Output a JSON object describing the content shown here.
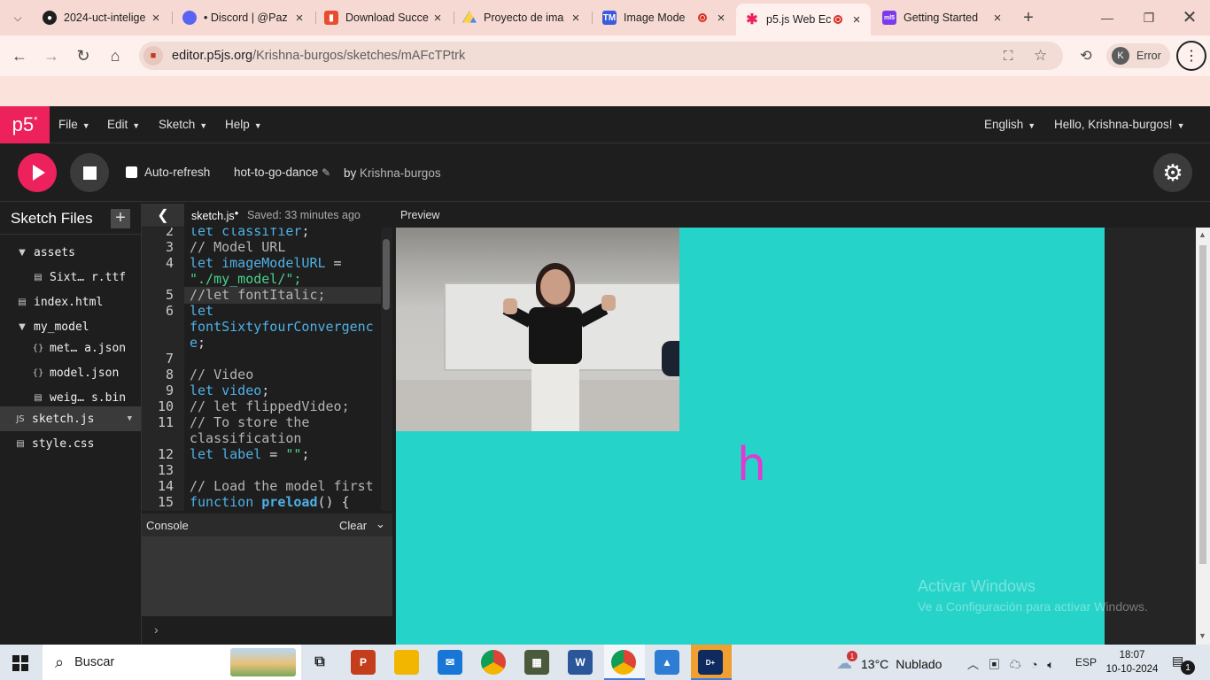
{
  "browser": {
    "tabs": [
      {
        "title": "2024-uct-intelige",
        "favicon": "github-icon",
        "color": "#1f1f1f"
      },
      {
        "title": "• Discord | @Paz",
        "favicon": "discord-icon",
        "color": "#5865f2"
      },
      {
        "title": "Download Succe",
        "favicon": "download-icon",
        "color": "#e94d2f"
      },
      {
        "title": "Proyecto de ima",
        "favicon": "google-drive-icon",
        "color": "#1fa463"
      },
      {
        "title": "Image Mode",
        "favicon": "teachable-machine-icon",
        "color": "#3b5bdb"
      },
      {
        "title": "p5.js Web Ec",
        "favicon": "p5js-icon",
        "color": "#ed225d"
      },
      {
        "title": "Getting Started",
        "favicon": "ml5-icon",
        "color": "#7c3aed"
      }
    ],
    "url_site": "editor.p5js.org",
    "url_path": "/Krishna-burgos/sketches/mAFcTPtrk",
    "profile_initial": "K",
    "profile_label": "Error"
  },
  "p5": {
    "logo": "p5",
    "menu": [
      "File",
      "Edit",
      "Sketch",
      "Help"
    ],
    "language": "English",
    "greeting": "Hello, Krishna-burgos!",
    "auto_refresh": "Auto-refresh",
    "sketch_name": "hot-to-go-dance",
    "by": "by",
    "author": "Krishna-burgos",
    "sidebar_title": "Sketch Files",
    "files": [
      {
        "name": "assets",
        "type": "folder"
      },
      {
        "name": "Sixt… r.ttf",
        "type": "file"
      },
      {
        "name": "index.html",
        "type": "html"
      },
      {
        "name": "my_model",
        "type": "folder"
      },
      {
        "name": "met… a.json",
        "type": "json"
      },
      {
        "name": "model.json",
        "type": "json"
      },
      {
        "name": "weig… s.bin",
        "type": "file"
      },
      {
        "name": "sketch.js",
        "type": "js"
      },
      {
        "name": "style.css",
        "type": "css"
      }
    ],
    "editor_tab": "sketch.js",
    "saved": "Saved: 33 minutes ago",
    "code_lines": [
      {
        "n": "2",
        "text": "let classifier;"
      },
      {
        "n": "3",
        "text": "// Model URL"
      },
      {
        "n": "4",
        "text": "let imageModelURL ="
      },
      {
        "n": "",
        "text": "\"./my_model/\";"
      },
      {
        "n": "5",
        "text": "//let fontItalic;"
      },
      {
        "n": "6",
        "text": "let"
      },
      {
        "n": "",
        "text": "fontSixtyfourConvergenc"
      },
      {
        "n": "",
        "text": "e;"
      },
      {
        "n": "7",
        "text": ""
      },
      {
        "n": "8",
        "text": "// Video"
      },
      {
        "n": "9",
        "text": "let video;"
      },
      {
        "n": "10",
        "text": "// let flippedVideo;"
      },
      {
        "n": "11",
        "text": "// To store the"
      },
      {
        "n": "",
        "text": "classification"
      },
      {
        "n": "12",
        "text": "let label = \"\";"
      },
      {
        "n": "13",
        "text": ""
      },
      {
        "n": "14",
        "text": "// Load the model first"
      },
      {
        "n": "15",
        "text": "function preload() {"
      }
    ],
    "console_title": "Console",
    "console_clear": "Clear",
    "console_prompt": "›",
    "preview_title": "Preview",
    "canvas_label": "h",
    "canvas_color": "#26d3c9",
    "label_color": "#e13ad0"
  },
  "watermark": {
    "line1": "Activar Windows",
    "line2": "Ve a Configuración para activar Windows."
  },
  "taskbar": {
    "search_placeholder": "Buscar",
    "weather_temp": "13°C",
    "weather_text": "Nublado",
    "weather_badge": "1",
    "language": "ESP",
    "time": "18:07",
    "date": "10-10-2024",
    "notification_count": "1"
  }
}
